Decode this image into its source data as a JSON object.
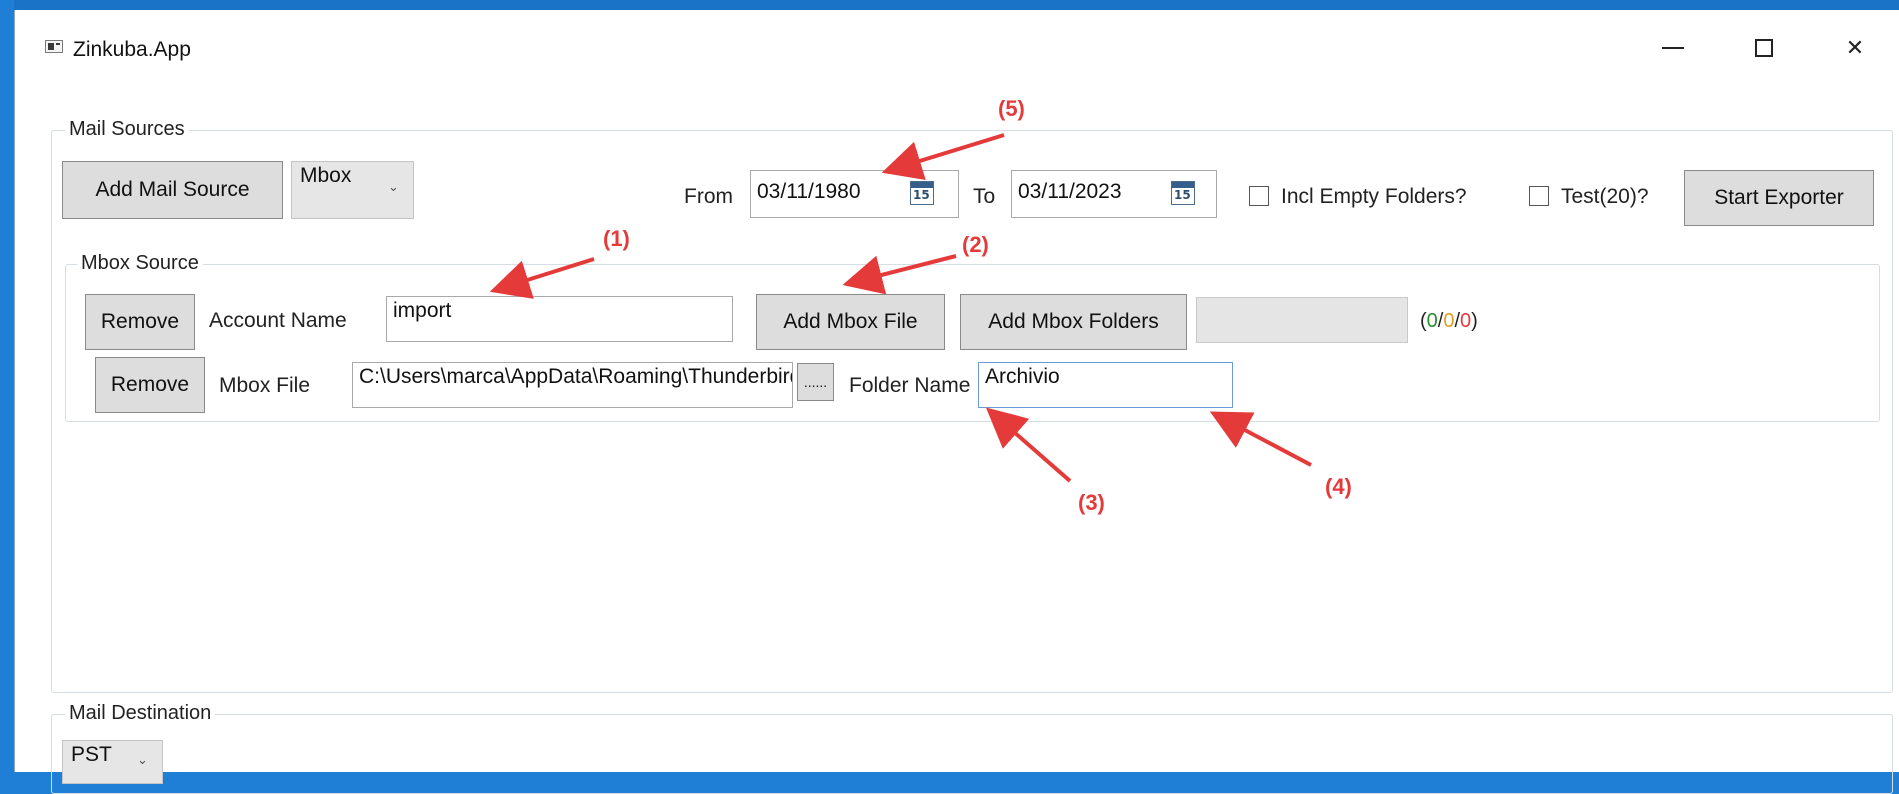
{
  "window": {
    "title": "Zinkuba.App"
  },
  "mail_sources": {
    "group_label": "Mail Sources",
    "add_source_button": "Add Mail Source",
    "source_type": "Mbox",
    "from_label": "From",
    "from_date": "03/11/1980",
    "to_label": "To",
    "to_date": "03/11/2023",
    "calendar_day": "15",
    "incl_empty_label": "Incl Empty Folders?",
    "incl_empty_checked": false,
    "test_label": "Test(20)?",
    "test_checked": false,
    "start_button": "Start Exporter"
  },
  "mbox_source": {
    "group_label": "Mbox Source",
    "remove_button": "Remove",
    "account_name_label": "Account Name",
    "account_name_value": "import",
    "add_file_button": "Add Mbox File",
    "add_folders_button": "Add Mbox Folders",
    "counts": {
      "open": "(",
      "a": "0",
      "sep1": "/",
      "b": "0",
      "sep2": "/",
      "c": "0",
      "close": ")"
    },
    "count_colors": {
      "a": "#2e8b2e",
      "b": "#e0a020",
      "c": "#e53a3a"
    },
    "file_row": {
      "remove_button": "Remove",
      "mbox_file_label": "Mbox File",
      "mbox_file_value": "C:\\Users\\marca\\AppData\\Roaming\\Thunderbird\\Pro",
      "browse_button": "......",
      "folder_name_label": "Folder Name",
      "folder_name_value": "Archivio"
    }
  },
  "mail_destination": {
    "group_label": "Mail Destination",
    "dest_type": "PST"
  },
  "annotations": {
    "labels": [
      "(1)",
      "(2)",
      "(3)",
      "(4)",
      "(5)"
    ],
    "color": "#e53a3a"
  }
}
